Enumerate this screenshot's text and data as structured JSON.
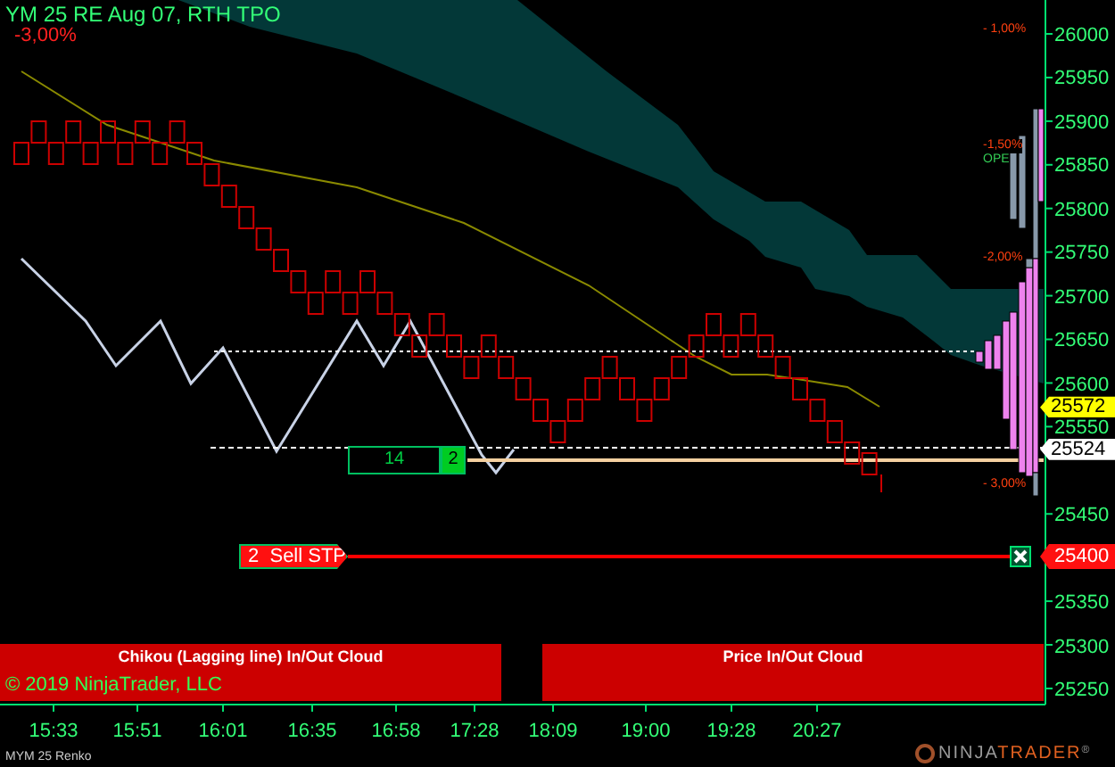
{
  "chart": {
    "title": "YM 25 RE Aug 07, RTH TPO",
    "change": "-3,00%",
    "levels": [
      {
        "label": "- 1,00%"
      },
      {
        "label": "-1,50%"
      },
      {
        "label": "-2,00%"
      },
      {
        "label": "- 3,00%"
      }
    ],
    "open_marker": "OPE",
    "price_axis": [
      "26000",
      "25950",
      "25900",
      "25850",
      "25800",
      "25750",
      "25700",
      "25650",
      "25600",
      "25550",
      "25450",
      "25350",
      "25300",
      "25250"
    ],
    "price_tags": [
      {
        "label": "25572",
        "color": "#ffff00"
      },
      {
        "label": "25524",
        "color": "#ffffff"
      }
    ],
    "time_axis": [
      "15:33",
      "15:51",
      "16:01",
      "16:35",
      "16:58",
      "17:28",
      "18:09",
      "19:00",
      "19:28",
      "20:27"
    ],
    "position": {
      "quantity": "14",
      "filled": "2"
    },
    "stop_order": {
      "label": "2  Sell STP",
      "price": "25400"
    },
    "indicator_bands": [
      {
        "label": "Chikou (Lagging line) In/Out Cloud"
      },
      {
        "label": "Price In/Out Cloud"
      }
    ],
    "copyright": "© 2019 NinjaTrader, LLC"
  },
  "footer": {
    "instrument": "MYM 25 Renko",
    "logo_parts": [
      "NINJA",
      "TRADER"
    ],
    "logo_mark": "®"
  }
}
